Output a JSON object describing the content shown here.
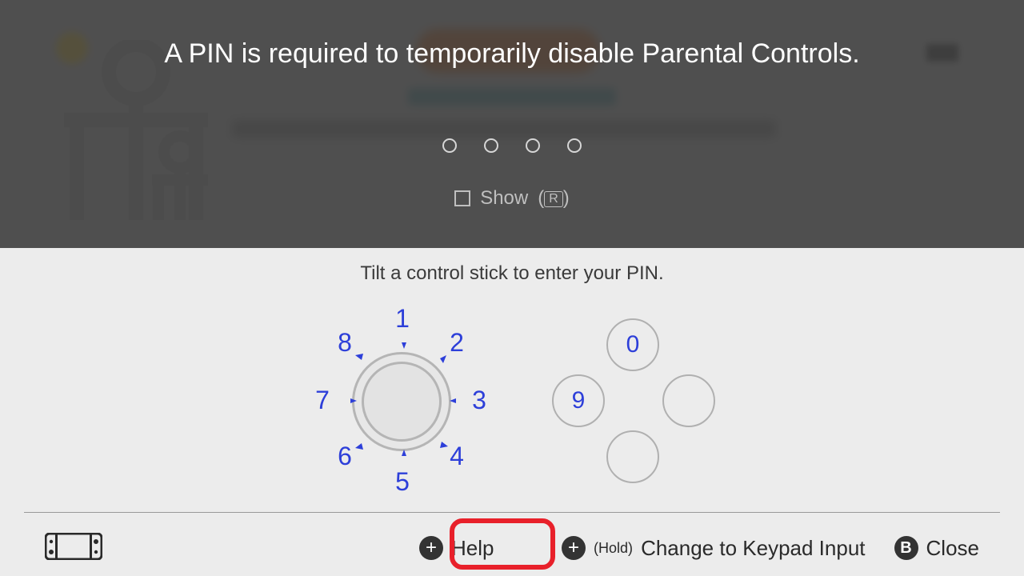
{
  "title": "A PIN is required to temporarily disable Parental Controls.",
  "show_label": "Show",
  "show_glyph": "R",
  "instruction": "Tilt a control stick to enter your PIN.",
  "wheel": {
    "n": "1",
    "ne": "2",
    "e": "3",
    "se": "4",
    "s": "5",
    "sw": "6",
    "w": "7",
    "nw": "8"
  },
  "pad": {
    "top": "0",
    "left": "9",
    "right": "",
    "bottom": ""
  },
  "footer": {
    "help": "Help",
    "hold": "(Hold)",
    "change": "Change to Keypad Input",
    "close": "Close",
    "plus_glyph": "+",
    "b_glyph": "B"
  }
}
